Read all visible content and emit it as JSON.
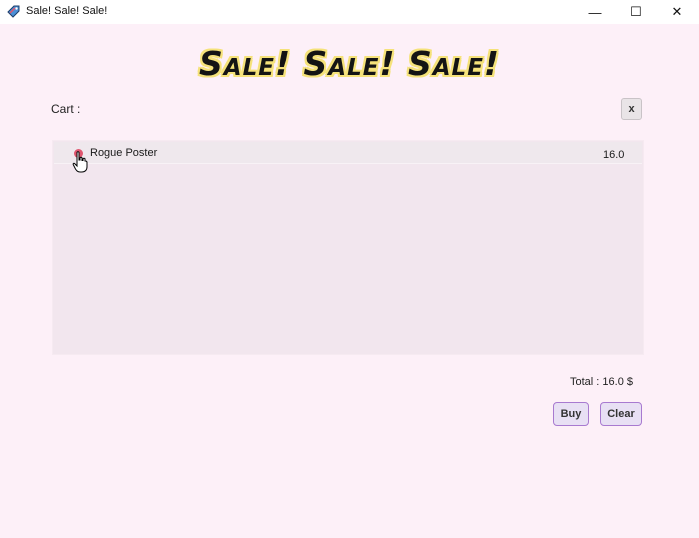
{
  "window": {
    "title": "Sale! Sale! Sale!",
    "minimize_glyph": "—",
    "maximize_glyph": "☐",
    "close_glyph": "✕",
    "icon": "app-tag-icon"
  },
  "header": {
    "headline": "Sale! Sale! Sale!"
  },
  "cart": {
    "label": "Cart :",
    "close_label": "x",
    "items": [
      {
        "name": "Rogue Poster",
        "price": "16.0",
        "icon": "remove-item-icon"
      }
    ],
    "total_text": "Total : 16.0 $"
  },
  "actions": {
    "buy_label": "Buy",
    "clear_label": "Clear"
  },
  "colors": {
    "background": "#fdf0f8",
    "list_background": "#f2e6ee",
    "headline_outline": "#f5e27a",
    "button_border": "#a87ad0",
    "remove_icon": "#e0566f"
  }
}
